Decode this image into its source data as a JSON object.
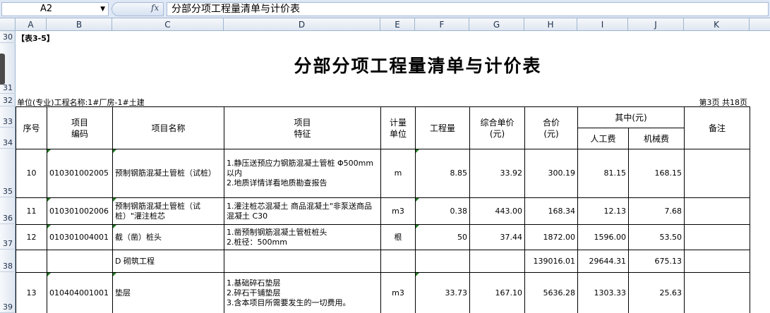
{
  "formula_bar": {
    "cell_ref": "A2",
    "fx_label": "fx",
    "content": "分部分项工程量清单与计价表"
  },
  "columns": [
    "A",
    "B",
    "C",
    "D",
    "E",
    "F",
    "G",
    "H",
    "I",
    "J",
    "K"
  ],
  "rows": [
    "30",
    "31",
    "32",
    "33",
    "34",
    "35",
    "36",
    "37",
    "38",
    "39"
  ],
  "sheet": {
    "tag": "【表3-5】",
    "title": "分部分项工程量清单与计价表",
    "project_name": "单位(专业)工程名称:1#厂房-1#土建",
    "page_info": "第3页 共18页"
  },
  "table_header": {
    "seq": "序号",
    "code": [
      "项目",
      "编码"
    ],
    "name": "项目名称",
    "feature": [
      "项目",
      "特征"
    ],
    "unit": [
      "计量",
      "单位"
    ],
    "quantity": "工程量",
    "unit_price": [
      "综合单价",
      "(元)"
    ],
    "total": [
      "合价",
      "(元)"
    ],
    "of_which": "其中(元)",
    "labor": "人工费",
    "machine": "机械费",
    "remark": "备注"
  },
  "table_rows": [
    {
      "seq": "10",
      "code": "010301002005",
      "name": "预制钢筋混凝土管桩（试桩）",
      "feature": [
        "1.静压送预应力钢筋混凝土管桩 Φ500mm以内",
        "2.地质详情详看地质勘查报告"
      ],
      "unit": "m",
      "qty": "8.85",
      "price": "33.92",
      "total": "300.19",
      "labor": "81.15",
      "machine": "168.15",
      "remark": ""
    },
    {
      "seq": "11",
      "code": "010301002006",
      "name": "预制钢筋混凝土管桩（试桩）\"灌注桩芯",
      "feature": [
        "1.灌注桩芯混凝土 商品混凝土\"非泵送商品混凝土 C30"
      ],
      "unit": "m3",
      "qty": "0.38",
      "price": "443.00",
      "total": "168.34",
      "labor": "12.13",
      "machine": "7.68",
      "remark": ""
    },
    {
      "seq": "12",
      "code": "010301004001",
      "name": "截（凿）桩头",
      "feature": [
        "1.凿预制钢筋混凝土管桩桩头",
        "2.桩径：500mm"
      ],
      "unit": "根",
      "qty": "50",
      "price": "37.44",
      "total": "1872.00",
      "labor": "1596.00",
      "machine": "53.50",
      "remark": ""
    },
    {
      "seq": "",
      "code": "",
      "name": "D 砌筑工程",
      "feature": [
        ""
      ],
      "unit": "",
      "qty": "",
      "price": "",
      "total": "139016.01",
      "labor": "29644.31",
      "machine": "675.13",
      "remark": ""
    },
    {
      "seq": "13",
      "code": "010404001001",
      "name": "垫层",
      "feature": [
        "1.基础碎石垫层",
        "2.碎石干铺垫层",
        "3.含本项目所需要发生的一切费用。"
      ],
      "unit": "m3",
      "qty": "33.73",
      "price": "167.10",
      "total": "5636.28",
      "labor": "1303.33",
      "machine": "25.63",
      "remark": ""
    }
  ]
}
